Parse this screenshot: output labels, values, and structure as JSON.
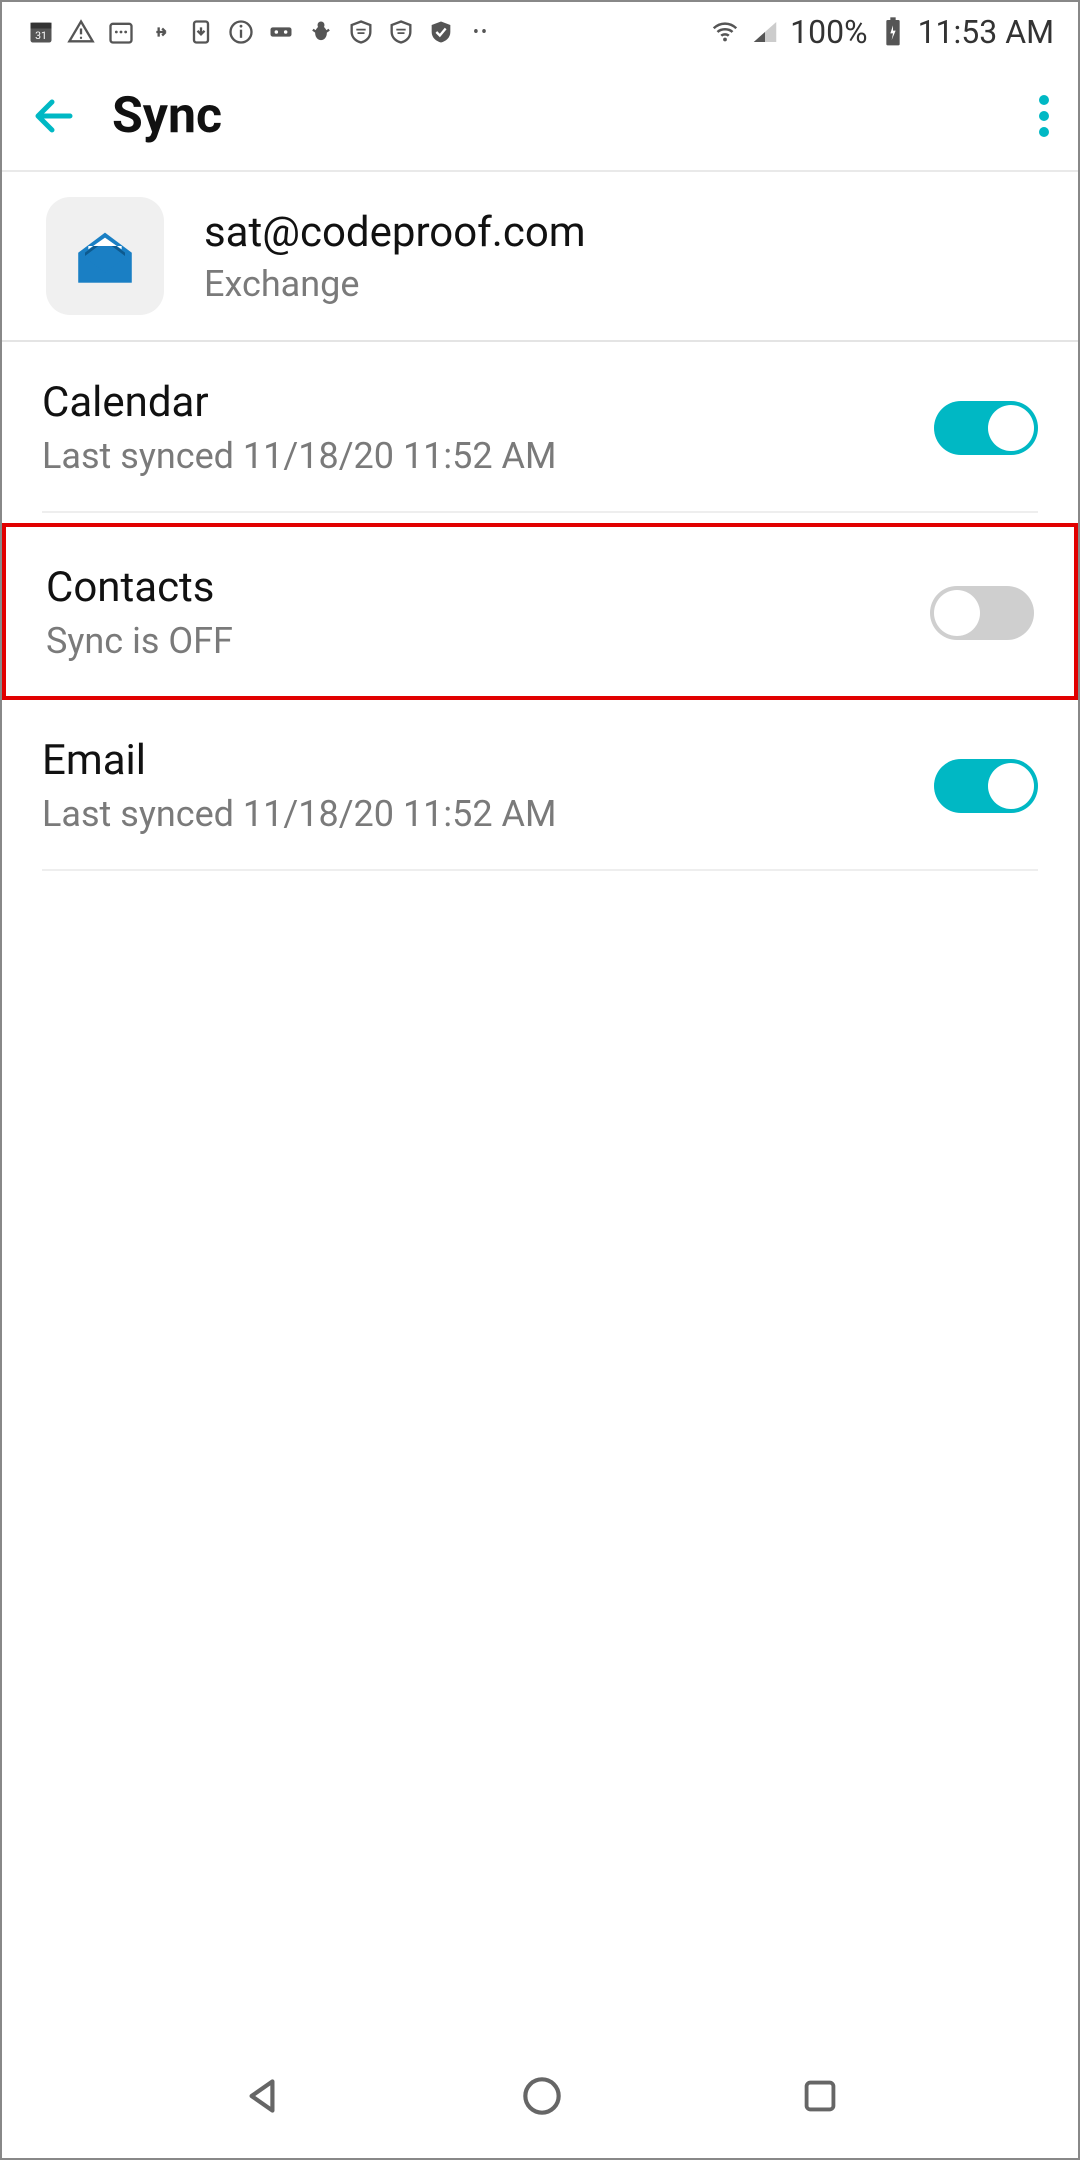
{
  "status_bar": {
    "battery_pct": "100%",
    "time": "11:53 AM"
  },
  "appbar": {
    "title": "Sync"
  },
  "account": {
    "email": "sat@codeproof.com",
    "type": "Exchange"
  },
  "sync_items": [
    {
      "title": "Calendar",
      "sub": "Last synced 11/18/20 11:52 AM",
      "on": true,
      "highlighted": false
    },
    {
      "title": "Contacts",
      "sub": "Sync is OFF",
      "on": false,
      "highlighted": true
    },
    {
      "title": "Email",
      "sub": "Last synced 11/18/20 11:52 AM",
      "on": true,
      "highlighted": false
    }
  ]
}
